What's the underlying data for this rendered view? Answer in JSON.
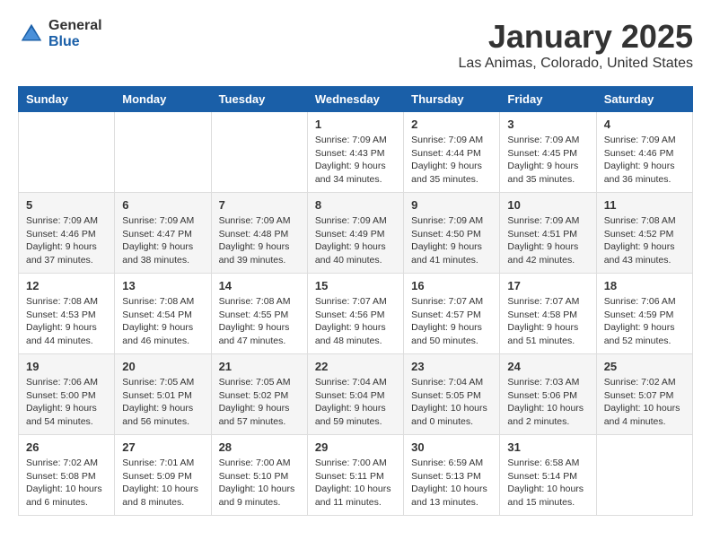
{
  "header": {
    "logo_general": "General",
    "logo_blue": "Blue",
    "month_title": "January 2025",
    "location": "Las Animas, Colorado, United States"
  },
  "weekdays": [
    "Sunday",
    "Monday",
    "Tuesday",
    "Wednesday",
    "Thursday",
    "Friday",
    "Saturday"
  ],
  "weeks": [
    [
      {
        "day": "",
        "info": ""
      },
      {
        "day": "",
        "info": ""
      },
      {
        "day": "",
        "info": ""
      },
      {
        "day": "1",
        "info": "Sunrise: 7:09 AM\nSunset: 4:43 PM\nDaylight: 9 hours\nand 34 minutes."
      },
      {
        "day": "2",
        "info": "Sunrise: 7:09 AM\nSunset: 4:44 PM\nDaylight: 9 hours\nand 35 minutes."
      },
      {
        "day": "3",
        "info": "Sunrise: 7:09 AM\nSunset: 4:45 PM\nDaylight: 9 hours\nand 35 minutes."
      },
      {
        "day": "4",
        "info": "Sunrise: 7:09 AM\nSunset: 4:46 PM\nDaylight: 9 hours\nand 36 minutes."
      }
    ],
    [
      {
        "day": "5",
        "info": "Sunrise: 7:09 AM\nSunset: 4:46 PM\nDaylight: 9 hours\nand 37 minutes."
      },
      {
        "day": "6",
        "info": "Sunrise: 7:09 AM\nSunset: 4:47 PM\nDaylight: 9 hours\nand 38 minutes."
      },
      {
        "day": "7",
        "info": "Sunrise: 7:09 AM\nSunset: 4:48 PM\nDaylight: 9 hours\nand 39 minutes."
      },
      {
        "day": "8",
        "info": "Sunrise: 7:09 AM\nSunset: 4:49 PM\nDaylight: 9 hours\nand 40 minutes."
      },
      {
        "day": "9",
        "info": "Sunrise: 7:09 AM\nSunset: 4:50 PM\nDaylight: 9 hours\nand 41 minutes."
      },
      {
        "day": "10",
        "info": "Sunrise: 7:09 AM\nSunset: 4:51 PM\nDaylight: 9 hours\nand 42 minutes."
      },
      {
        "day": "11",
        "info": "Sunrise: 7:08 AM\nSunset: 4:52 PM\nDaylight: 9 hours\nand 43 minutes."
      }
    ],
    [
      {
        "day": "12",
        "info": "Sunrise: 7:08 AM\nSunset: 4:53 PM\nDaylight: 9 hours\nand 44 minutes."
      },
      {
        "day": "13",
        "info": "Sunrise: 7:08 AM\nSunset: 4:54 PM\nDaylight: 9 hours\nand 46 minutes."
      },
      {
        "day": "14",
        "info": "Sunrise: 7:08 AM\nSunset: 4:55 PM\nDaylight: 9 hours\nand 47 minutes."
      },
      {
        "day": "15",
        "info": "Sunrise: 7:07 AM\nSunset: 4:56 PM\nDaylight: 9 hours\nand 48 minutes."
      },
      {
        "day": "16",
        "info": "Sunrise: 7:07 AM\nSunset: 4:57 PM\nDaylight: 9 hours\nand 50 minutes."
      },
      {
        "day": "17",
        "info": "Sunrise: 7:07 AM\nSunset: 4:58 PM\nDaylight: 9 hours\nand 51 minutes."
      },
      {
        "day": "18",
        "info": "Sunrise: 7:06 AM\nSunset: 4:59 PM\nDaylight: 9 hours\nand 52 minutes."
      }
    ],
    [
      {
        "day": "19",
        "info": "Sunrise: 7:06 AM\nSunset: 5:00 PM\nDaylight: 9 hours\nand 54 minutes."
      },
      {
        "day": "20",
        "info": "Sunrise: 7:05 AM\nSunset: 5:01 PM\nDaylight: 9 hours\nand 56 minutes."
      },
      {
        "day": "21",
        "info": "Sunrise: 7:05 AM\nSunset: 5:02 PM\nDaylight: 9 hours\nand 57 minutes."
      },
      {
        "day": "22",
        "info": "Sunrise: 7:04 AM\nSunset: 5:04 PM\nDaylight: 9 hours\nand 59 minutes."
      },
      {
        "day": "23",
        "info": "Sunrise: 7:04 AM\nSunset: 5:05 PM\nDaylight: 10 hours\nand 0 minutes."
      },
      {
        "day": "24",
        "info": "Sunrise: 7:03 AM\nSunset: 5:06 PM\nDaylight: 10 hours\nand 2 minutes."
      },
      {
        "day": "25",
        "info": "Sunrise: 7:02 AM\nSunset: 5:07 PM\nDaylight: 10 hours\nand 4 minutes."
      }
    ],
    [
      {
        "day": "26",
        "info": "Sunrise: 7:02 AM\nSunset: 5:08 PM\nDaylight: 10 hours\nand 6 minutes."
      },
      {
        "day": "27",
        "info": "Sunrise: 7:01 AM\nSunset: 5:09 PM\nDaylight: 10 hours\nand 8 minutes."
      },
      {
        "day": "28",
        "info": "Sunrise: 7:00 AM\nSunset: 5:10 PM\nDaylight: 10 hours\nand 9 minutes."
      },
      {
        "day": "29",
        "info": "Sunrise: 7:00 AM\nSunset: 5:11 PM\nDaylight: 10 hours\nand 11 minutes."
      },
      {
        "day": "30",
        "info": "Sunrise: 6:59 AM\nSunset: 5:13 PM\nDaylight: 10 hours\nand 13 minutes."
      },
      {
        "day": "31",
        "info": "Sunrise: 6:58 AM\nSunset: 5:14 PM\nDaylight: 10 hours\nand 15 minutes."
      },
      {
        "day": "",
        "info": ""
      }
    ]
  ]
}
